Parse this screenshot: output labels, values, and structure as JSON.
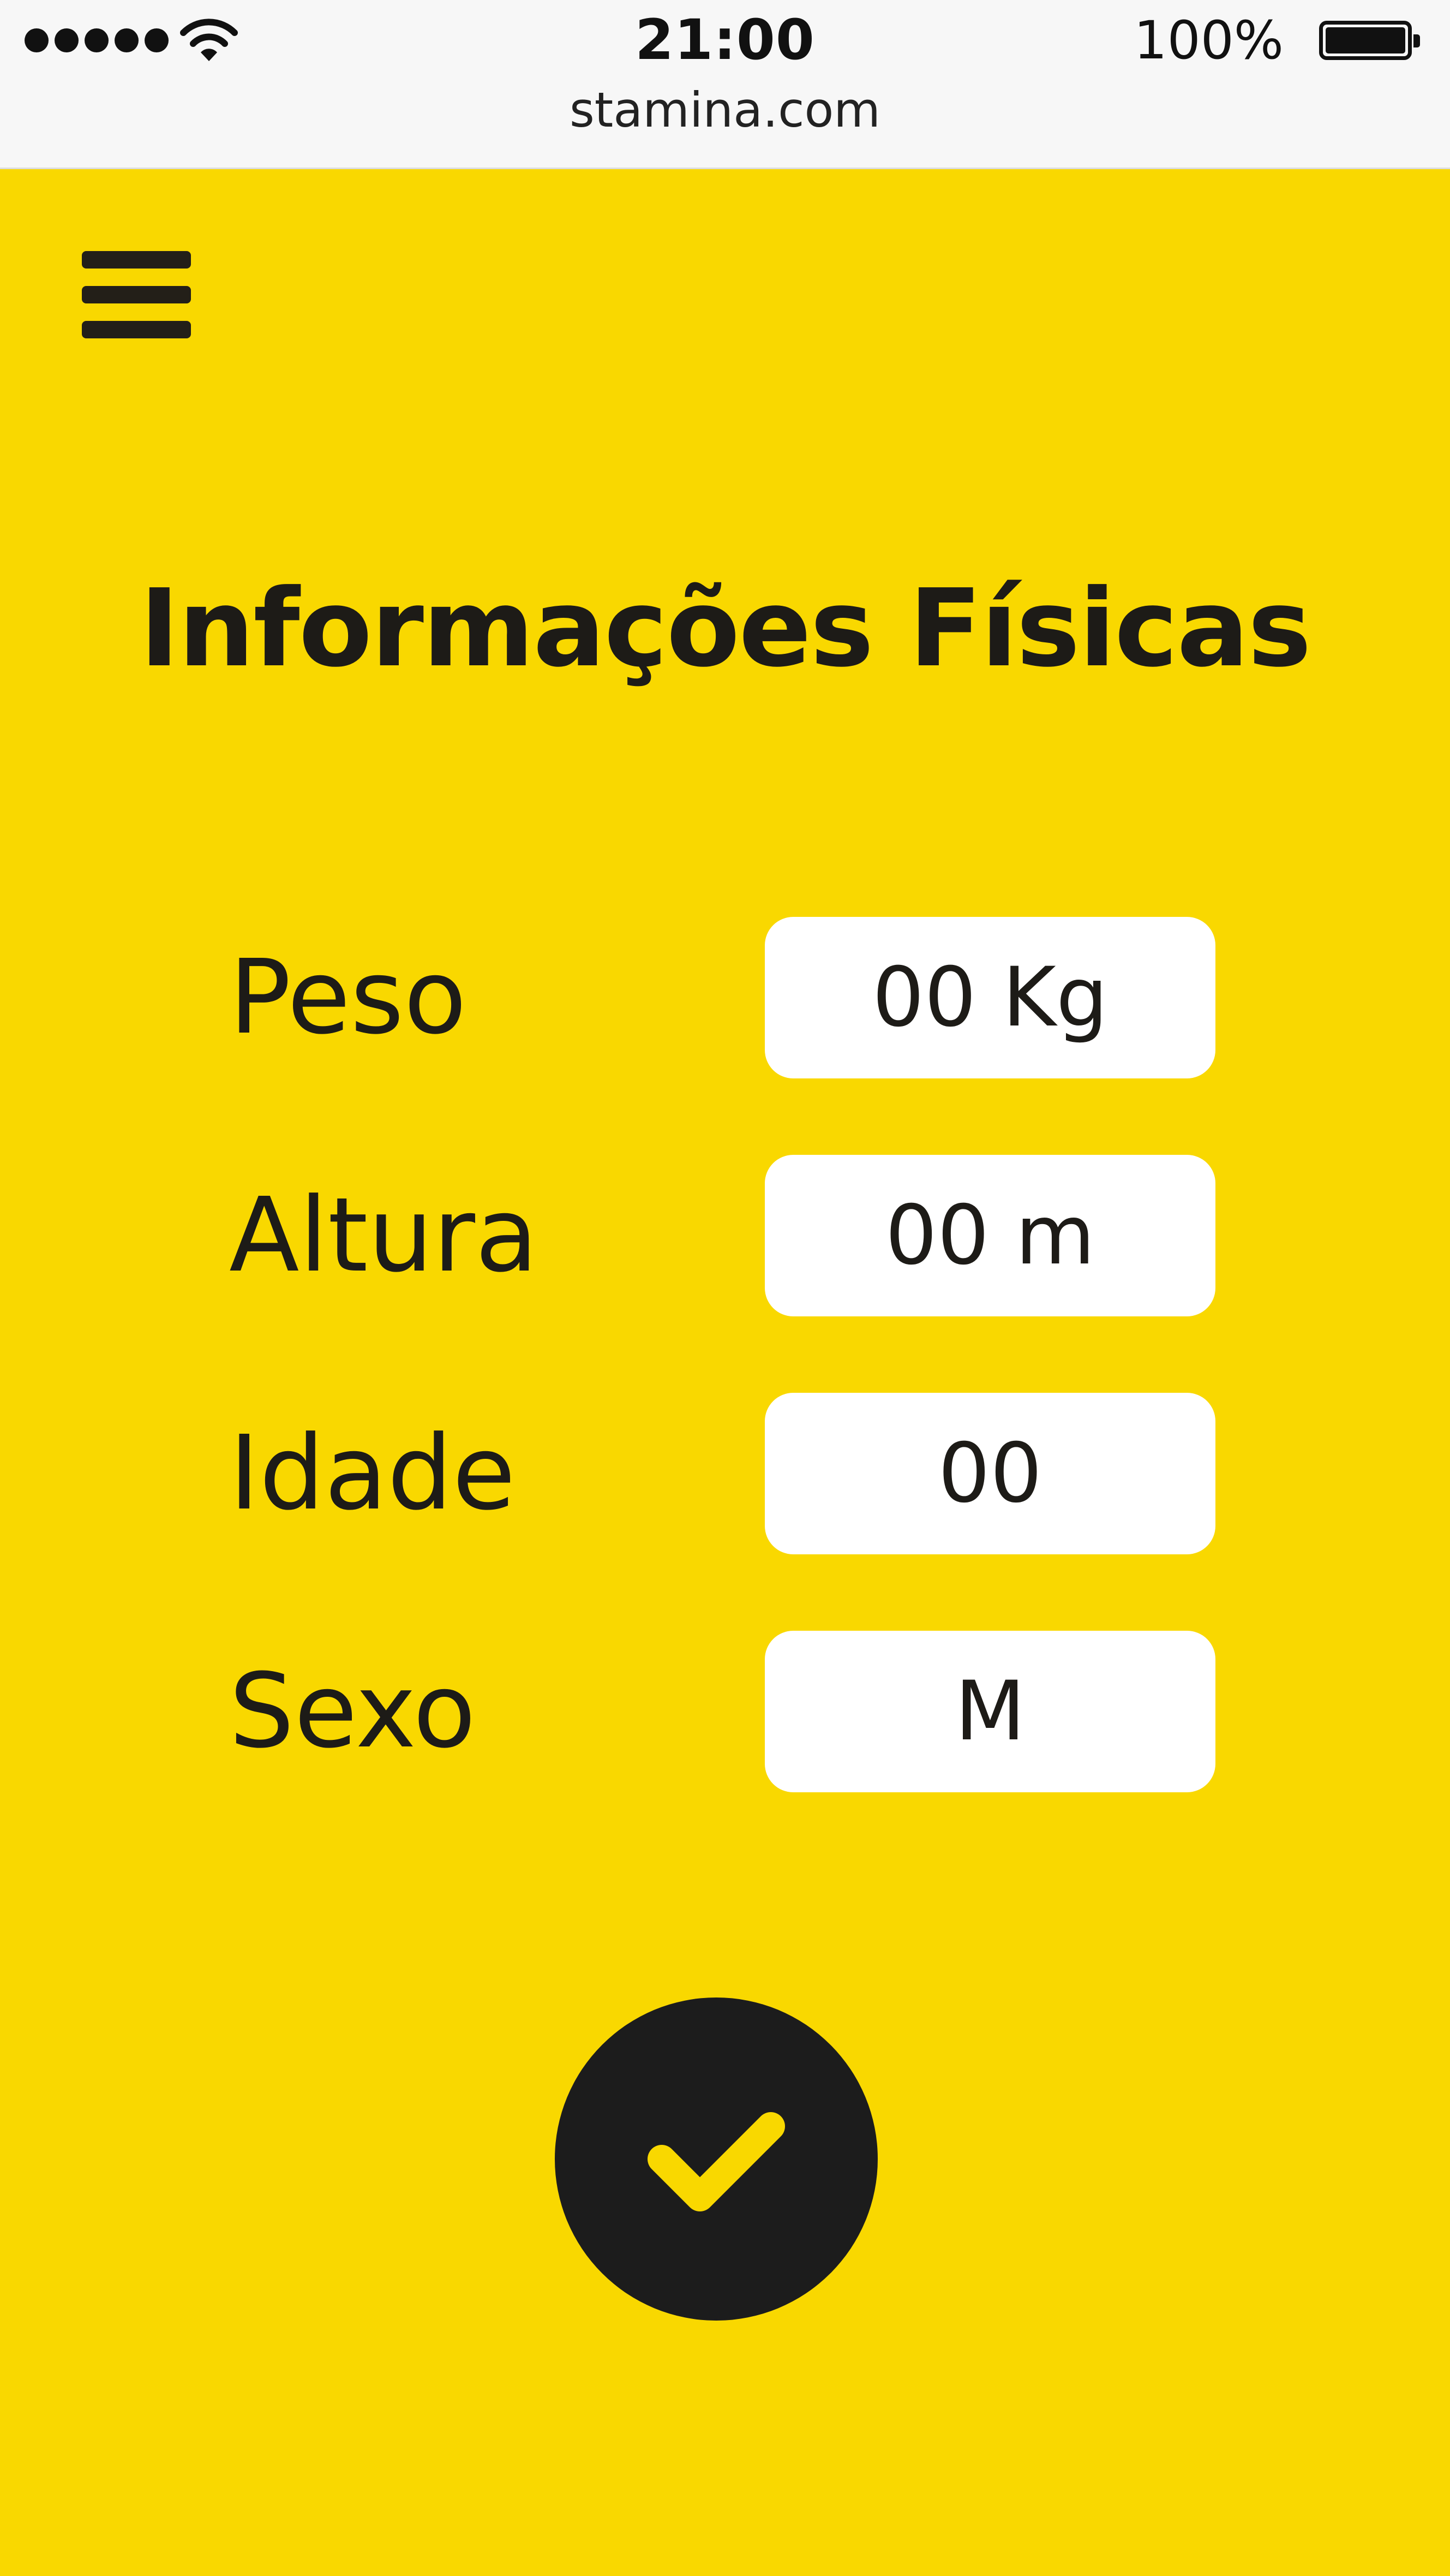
{
  "status_bar": {
    "time": "21:00",
    "battery_percent": "100%",
    "url": "stamina.com",
    "signal_icon": "signal-dots-icon",
    "wifi_icon": "wifi-icon",
    "battery_icon": "battery-icon"
  },
  "header": {
    "menu_icon": "hamburger-menu-icon"
  },
  "form": {
    "title": "Informações Físicas",
    "fields": [
      {
        "label": "Peso",
        "value": "00 Kg"
      },
      {
        "label": "Altura",
        "value": "00 m"
      },
      {
        "label": "Idade",
        "value": "00"
      },
      {
        "label": "Sexo",
        "value": "M"
      }
    ],
    "confirm_icon": "checkmark-icon"
  },
  "colors": {
    "background": "#f9d800",
    "text": "#1d1b17",
    "field_background": "#ffffff",
    "button_background": "#1c1c1c",
    "check_color": "#f9d800"
  }
}
